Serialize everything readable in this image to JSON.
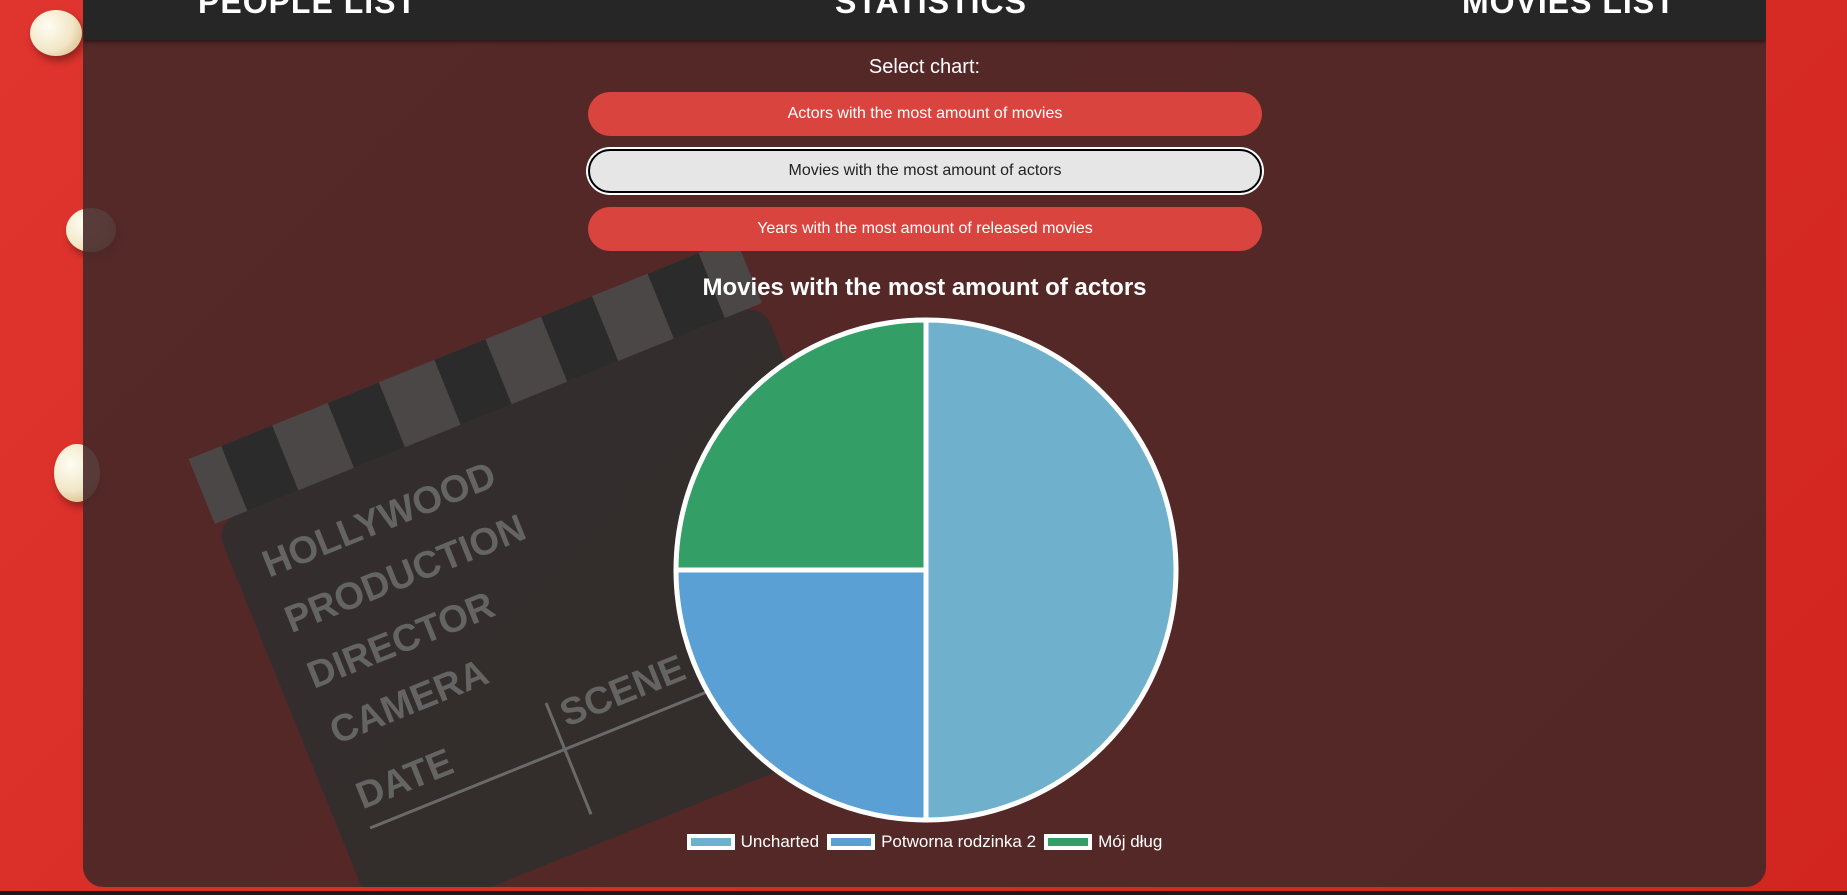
{
  "nav": {
    "people": "PEOPLE LIST",
    "statistics": "STATISTICS",
    "movies": "MOVIES LIST"
  },
  "select_label": "Select chart:",
  "chart_buttons": [
    "Actors with the most amount of movies",
    "Movies with the most amount of actors",
    "Years with the most amount of released movies"
  ],
  "active_button_index": 1,
  "background_clapperboard_text": [
    "HOLLYWOOD",
    "PRODUCTION",
    "DIRECTOR",
    "CAMERA",
    "DATE",
    "SCENE"
  ],
  "chart_data": {
    "type": "pie",
    "title": "Movies with the most amount of actors",
    "categories": [
      "Uncharted",
      "Potworna rodzinka 2",
      "Mój dług"
    ],
    "values": [
      2,
      1,
      1
    ],
    "colors": [
      "#6fb0cc",
      "#5aa0d5",
      "#339f66"
    ],
    "legend_position": "bottom"
  }
}
